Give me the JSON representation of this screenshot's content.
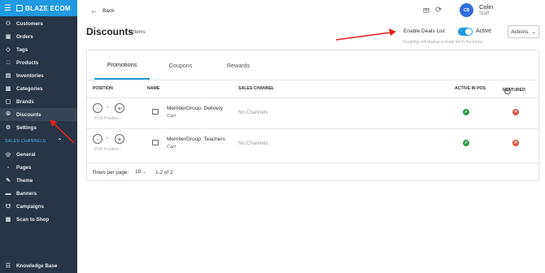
{
  "app": {
    "brand": "BLAZE ECOM"
  },
  "sidebar": {
    "items": [
      {
        "label": "Customers",
        "icon": "users-icon"
      },
      {
        "label": "Orders",
        "icon": "orders-icon"
      },
      {
        "label": "Tags",
        "icon": "tag-icon"
      },
      {
        "label": "Products",
        "icon": "box-icon"
      },
      {
        "label": "Inventories",
        "icon": "clipboard-icon"
      },
      {
        "label": "Categories",
        "icon": "categories-icon"
      },
      {
        "label": "Brands",
        "icon": "brand-icon"
      },
      {
        "label": "Discounts",
        "icon": "discount-icon",
        "active": true
      },
      {
        "label": "Settings",
        "icon": "gear-icon"
      }
    ],
    "section_title": "SALES CHANNELS",
    "channel_items": [
      {
        "label": "General",
        "icon": "globe-icon"
      },
      {
        "label": "Pages",
        "icon": "pages-icon"
      },
      {
        "label": "Theme",
        "icon": "brush-icon"
      },
      {
        "label": "Banners",
        "icon": "banner-icon"
      },
      {
        "label": "Campaigns",
        "icon": "bell-icon"
      },
      {
        "label": "Scan to Shop",
        "icon": "scan-icon"
      }
    ],
    "bottom_item": {
      "label": "Knowledge Base",
      "icon": "book-icon"
    }
  },
  "topbar": {
    "back_label": "Back",
    "user_initials": "CB",
    "user_name": "Colin",
    "user_role": "Staff"
  },
  "page": {
    "title": "Discounts",
    "count": "2 Items",
    "deals_toggle_label": "Enable Deals List",
    "deals_toggle_state": "Active",
    "deals_help": "Enabling will display a deals list in the menu.",
    "actions_label": "Actions"
  },
  "tabs": [
    {
      "label": "Promotions",
      "selected": true
    },
    {
      "label": "Coupons",
      "selected": false
    },
    {
      "label": "Rewards",
      "selected": false
    }
  ],
  "table": {
    "headers": {
      "position": "POSITION",
      "name": "NAME",
      "channel": "SALES CHANNEL",
      "active": "ACTIVE IN POS",
      "featured": "FEATURED"
    },
    "rows": [
      {
        "minus": "-",
        "position": "-",
        "plus": "+",
        "pos_label": "POS Position: -",
        "name": "MemberGroup: Delivery",
        "type": "Cart",
        "channel": "No Channels",
        "active_in_pos": true,
        "featured": false
      },
      {
        "minus": "-",
        "position": "-",
        "plus": "+",
        "pos_label": "POS Position: -",
        "name": "MemberGroup: Teachers",
        "type": "Cart",
        "channel": "No Channels",
        "active_in_pos": true,
        "featured": false
      }
    ]
  },
  "pagination": {
    "rows_label": "Rows per page:",
    "rows_value": "10",
    "range": "1-2 of 2"
  },
  "colors": {
    "sidebar_bg": "#263646",
    "brand_bg": "#1f9ae0",
    "accent": "#1f9ae0",
    "success": "#2e9e4a",
    "danger": "#e0513a",
    "annotation": "#e02020"
  }
}
